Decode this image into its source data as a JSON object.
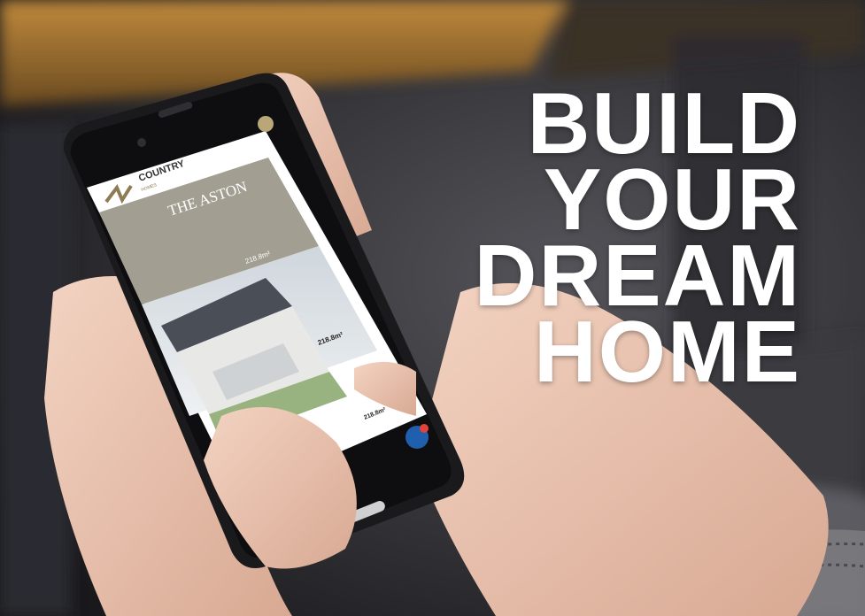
{
  "headline": {
    "lines": [
      "BUILD",
      "YOUR",
      "DREAM",
      "HOME"
    ]
  },
  "phone": {
    "brand": {
      "name": "COUNTRY",
      "tagline": "HOMES"
    },
    "page_title": "THE ASTON",
    "area": "218.8m²",
    "table_area": "218.8m²"
  },
  "colors": {
    "headline": "#ffffff",
    "phone_banner": "#a39e92",
    "chat_button": "#1f5fae",
    "chat_badge": "#e2423a"
  }
}
